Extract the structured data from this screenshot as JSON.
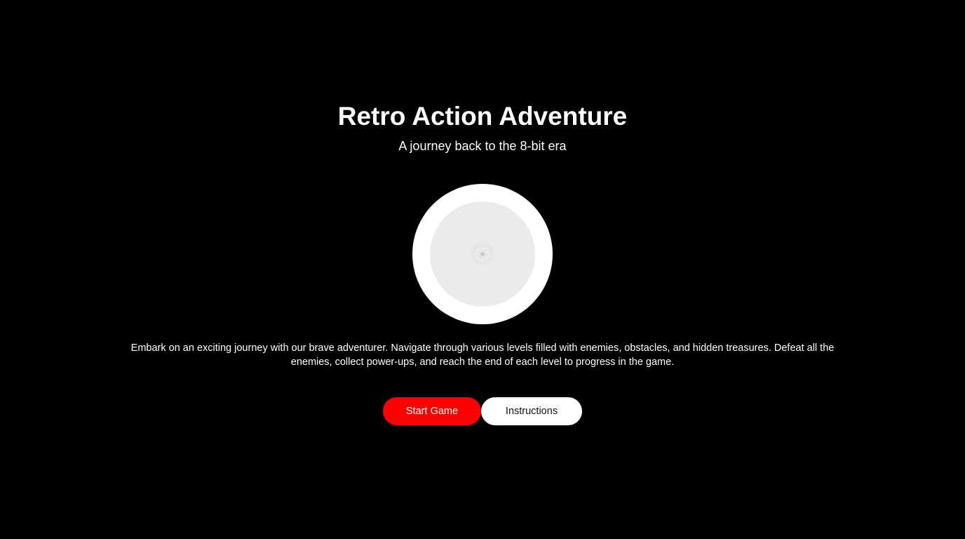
{
  "header": {
    "title": "Retro Action Adventure",
    "subtitle": "A journey back to the 8-bit era"
  },
  "hero": {
    "icon": "loading-spinner-icon"
  },
  "main": {
    "description": "Embark on an exciting journey with our brave adventurer. Navigate through various levels filled with enemies, obstacles, and hidden treasures. Defeat all the enemies, collect power-ups, and reach the end of each level to progress in the game."
  },
  "actions": {
    "start_label": "Start Game",
    "instructions_label": "Instructions"
  },
  "colors": {
    "background": "#000000",
    "accent": "#ff0000",
    "text": "#ffffff"
  }
}
